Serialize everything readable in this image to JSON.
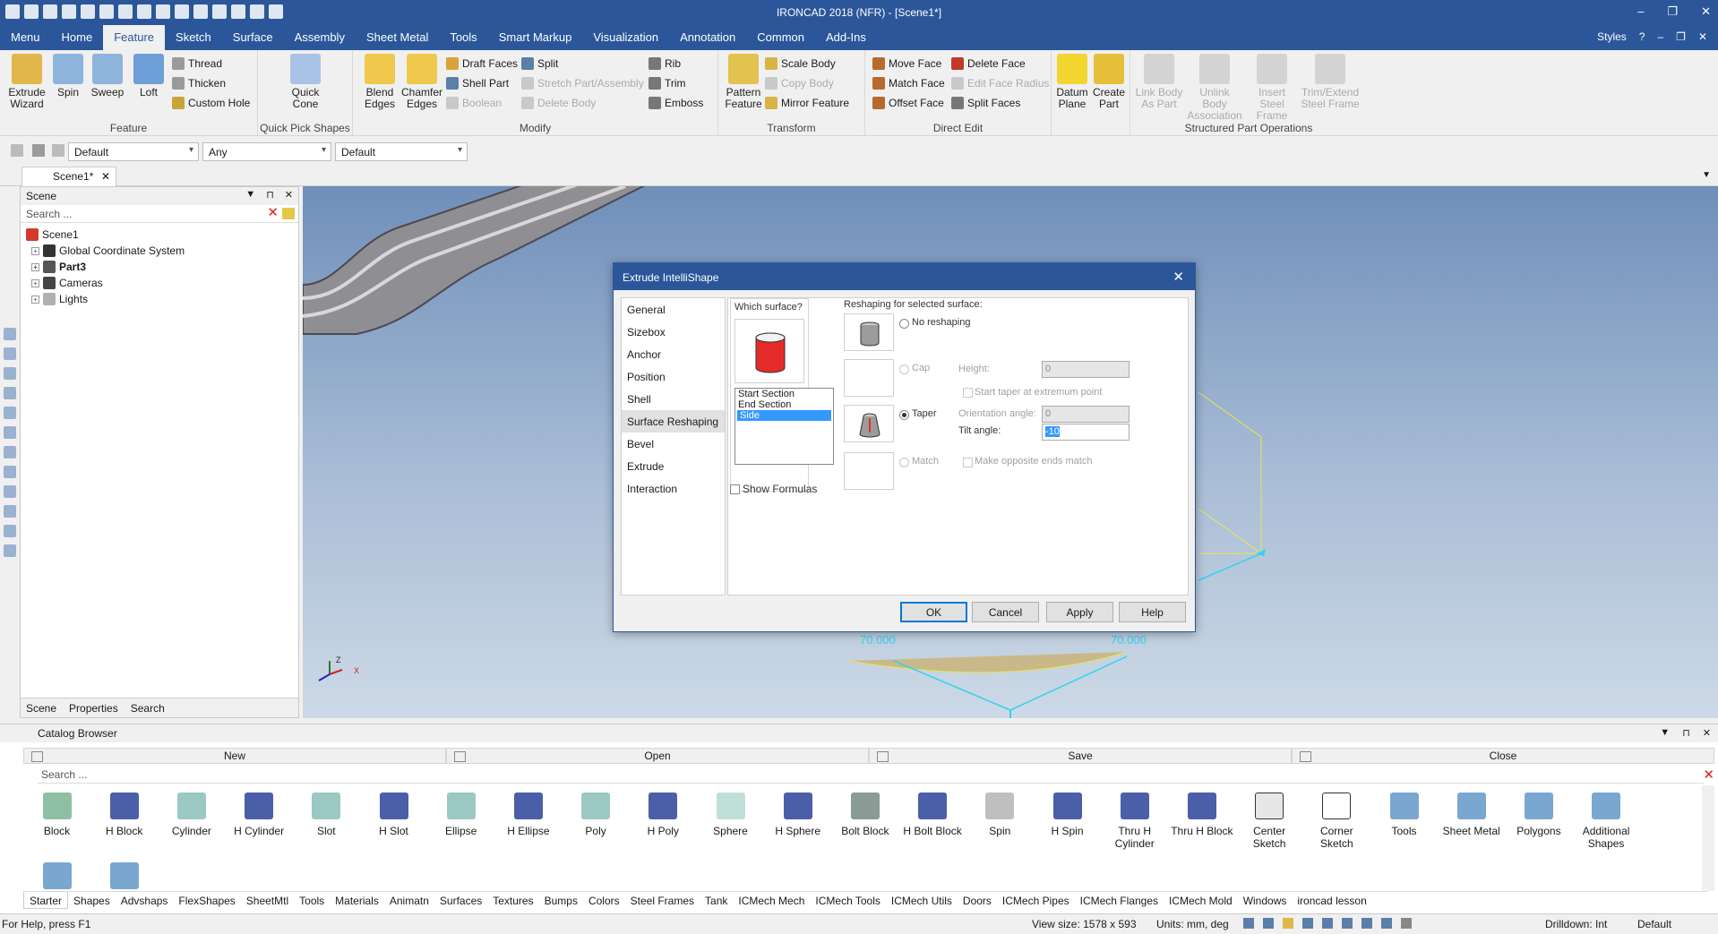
{
  "titlebar": {
    "title": "IRONCAD 2018 (NFR) - [Scene1*]",
    "min": "–",
    "restore": "❐",
    "close": "✕"
  },
  "menu": {
    "items": [
      "Menu",
      "Home",
      "Feature",
      "Sketch",
      "Surface",
      "Assembly",
      "Sheet Metal",
      "Tools",
      "Smart Markup",
      "Visualization",
      "Annotation",
      "Common",
      "Add-Ins"
    ],
    "active": "Feature",
    "styles": "Styles",
    "help": "?"
  },
  "ribbon": {
    "feature": {
      "label": "Feature",
      "extrude": "Extrude Wizard",
      "spin": "Spin",
      "sweep": "Sweep",
      "loft": "Loft",
      "thread": "Thread",
      "thicken": "Thicken",
      "custom_hole": "Custom Hole"
    },
    "quick": {
      "label": "Quick Pick Shapes",
      "quick_cone": "Quick Cone"
    },
    "modify": {
      "label": "Modify",
      "blend": "Blend Edges",
      "chamfer": "Chamfer Edges",
      "draft_faces": "Draft Faces",
      "shell_part": "Shell Part",
      "boolean": "Boolean",
      "split": "Split",
      "stretch": "Stretch Part/Assembly",
      "delete_body": "Delete Body",
      "rib": "Rib",
      "trim": "Trim",
      "emboss": "Emboss"
    },
    "transform": {
      "label": "Transform",
      "pattern": "Pattern Feature",
      "scale_body": "Scale Body",
      "copy_body": "Copy Body",
      "mirror": "Mirror Feature"
    },
    "direct": {
      "label": "Direct Edit",
      "move_face": "Move Face",
      "match_face": "Match Face",
      "offset_face": "Offset Face",
      "delete_face": "Delete Face",
      "edit_face_radius": "Edit Face Radius",
      "split_faces": "Split Faces"
    },
    "datum": {
      "datum_plane": "Datum Plane",
      "create_part": "Create Part"
    },
    "structured": {
      "label": "Structured Part Operations",
      "link_body": "Link Body As Part",
      "unlink_body": "Unlink Body Association",
      "insert_steel": "Insert Steel Frame",
      "trim_extend": "Trim/Extend Steel Frame"
    }
  },
  "toolbar2": {
    "combo1": "Default",
    "combo2": "Any",
    "combo3": "Default"
  },
  "doc_tab": {
    "label": "Scene1*",
    "close": "✕"
  },
  "scene_panel": {
    "title": "Scene",
    "search_placeholder": "Search ...",
    "tree": [
      "Scene1",
      "Global Coordinate System",
      "Part3",
      "Cameras",
      "Lights"
    ],
    "tabs": [
      "Scene",
      "Properties",
      "Search"
    ]
  },
  "dialog": {
    "title": "Extrude IntelliShape",
    "nav": [
      "General",
      "Sizebox",
      "Anchor",
      "Position",
      "Shell",
      "Surface Reshaping",
      "Bevel",
      "Extrude",
      "Interaction"
    ],
    "nav_selected": "Surface Reshaping",
    "which_surface": "Which surface?",
    "surfaces": [
      "Start Section",
      "End Section",
      "Side"
    ],
    "surface_selected": "Side",
    "show_formulas": "Show Formulas",
    "reshaping_title": "Reshaping for selected surface:",
    "no_reshaping": "No reshaping",
    "cap": "Cap",
    "height_label": "Height:",
    "height_value": "0",
    "start_taper": "Start taper at extremum point",
    "taper": "Taper",
    "orientation_label": "Orientation angle:",
    "orientation_value": "0",
    "tilt_label": "Tilt angle:",
    "tilt_value": "-10",
    "match": "Match",
    "make_opposite": "Make opposite ends match",
    "selected_option": "Taper",
    "ok": "OK",
    "cancel": "Cancel",
    "apply": "Apply",
    "help": "Help"
  },
  "viewport": {
    "dim_left": "70.000",
    "dim_right": "70.000",
    "axis_z": "Z",
    "axis_x": "X"
  },
  "catalog": {
    "title": "Catalog Browser",
    "buttons": [
      "New",
      "Open",
      "Save",
      "Close"
    ],
    "search_placeholder": "Search ...",
    "shapes": [
      "Block",
      "H Block",
      "Cylinder",
      "H Cylinder",
      "Slot",
      "H Slot",
      "Ellipse",
      "H Ellipse",
      "Poly",
      "H Poly",
      "Sphere",
      "H Sphere",
      "Bolt Block",
      "H Bolt Block",
      "Spin",
      "H Spin",
      "Thru H Cylinder",
      "Thru H Block",
      "Center Sketch",
      "Corner Sketch",
      "Tools",
      "Sheet Metal",
      "Polygons",
      "Additional Shapes"
    ],
    "tabs": [
      "Starter",
      "Shapes",
      "Advshaps",
      "FlexShapes",
      "SheetMtl",
      "Tools",
      "Materials",
      "Animatn",
      "Surfaces",
      "Textures",
      "Bumps",
      "Colors",
      "Steel Frames",
      "Tank",
      "ICMech Mech",
      "ICMech Tools",
      "ICMech Utils",
      "Doors",
      "ICMech Pipes",
      "ICMech Flanges",
      "ICMech Mold",
      "Windows",
      "ironcad lesson"
    ],
    "tab_selected": "Starter"
  },
  "status": {
    "help": "For Help, press F1",
    "view_size": "View size: 1578 x 593",
    "units": "Units: mm, deg",
    "drilldown": "Drilldown: Int",
    "style": "Default"
  },
  "colors": {
    "accent": "#2b579a",
    "selection": "#3399ff",
    "sketch_yellow": "#e8e84a",
    "dim_cyan": "#31d3f0"
  }
}
